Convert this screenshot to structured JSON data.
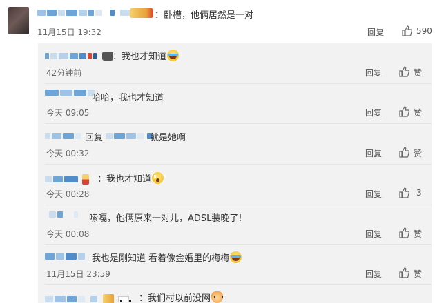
{
  "top_comment": {
    "text": "：卧槽，他俩居然是一对",
    "time": "11月15日 19:32",
    "reply_label": "回复",
    "like_count": "590"
  },
  "replies": [
    {
      "text": "：我也才知道",
      "emoji": "laugh",
      "time": "42分钟前",
      "reply_label": "回复",
      "like_label": "赞"
    },
    {
      "text": "哈哈，我也才知道",
      "time": "今天 09:05",
      "reply_label": "回复",
      "like_label": "赞"
    },
    {
      "reply_prefix": "回复",
      "text": "就是她啊",
      "time": "今天 00:32",
      "reply_label": "回复",
      "like_label": "赞"
    },
    {
      "text": "：我也才知道",
      "emoji": "shock",
      "time": "今天 00:28",
      "reply_label": "回复",
      "like_count": "3"
    },
    {
      "text": "嗦嘎，他俩原来一对儿，ADSL装晚了!",
      "time": "今天 00:08",
      "reply_label": "回复",
      "like_label": "赞"
    },
    {
      "text": "我也是刚知道  看着像金婚里的梅梅",
      "emoji": "laugh",
      "time": "11月15日 23:59",
      "reply_label": "回复",
      "like_label": "赞"
    },
    {
      "text": "：我们村以前没网",
      "emoji": "cat"
    }
  ],
  "colors": {
    "mosaic_blue": "#6fa5d6",
    "mosaic_light": "#c9ddef",
    "panel_bg": "#f2f2f2"
  }
}
